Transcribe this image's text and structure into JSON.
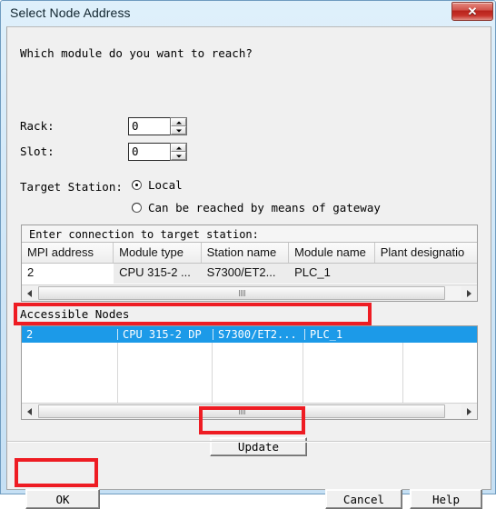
{
  "window": {
    "title": "Select Node Address",
    "close_icon": "close-x-icon",
    "close_label": "✕"
  },
  "dialog": {
    "question": "Which module do you want to reach?",
    "fields": [
      {
        "label": "Rack:",
        "value": "0"
      },
      {
        "label": "Slot:",
        "value": "0"
      }
    ],
    "target_station": {
      "label": "Target Station:",
      "options": [
        {
          "label": "Local",
          "selected": true
        },
        {
          "label": "Can be reached by means of gateway",
          "selected": false
        }
      ]
    }
  },
  "connection_table": {
    "caption": "Enter connection to target station:",
    "columns": [
      "MPI address",
      "Module type",
      "Station name",
      "Module name",
      "Plant designatio"
    ],
    "rows": [
      [
        "2",
        "CPU 315-2 ...",
        "S7300/ET2...",
        "PLC_1",
        ""
      ]
    ],
    "scrollbar": {
      "left_arrow": "scroll-left-icon",
      "right_arrow": "scroll-right-icon"
    }
  },
  "accessible_nodes": {
    "label": "Accessible Nodes",
    "rows": [
      {
        "mpi_address": "2",
        "module_type": "CPU 315-2 DP",
        "station_name": "S7300/ET2...",
        "module_name": "PLC_1",
        "selected": true
      }
    ],
    "scrollbar": {
      "left_arrow": "scroll-left-icon",
      "right_arrow": "scroll-right-icon"
    }
  },
  "buttons": {
    "update": "Update",
    "ok": "OK",
    "cancel": "Cancel",
    "help": "Help"
  },
  "annotations": {
    "color": "#ee1c23",
    "highlighted": [
      "accessible-node-row",
      "update-button",
      "ok-button"
    ]
  },
  "colors": {
    "titlebar": "#cfe6f7",
    "close_button": "#c7322a",
    "selection": "#1c9ae8",
    "dialog_bg": "#f0f0f0"
  }
}
